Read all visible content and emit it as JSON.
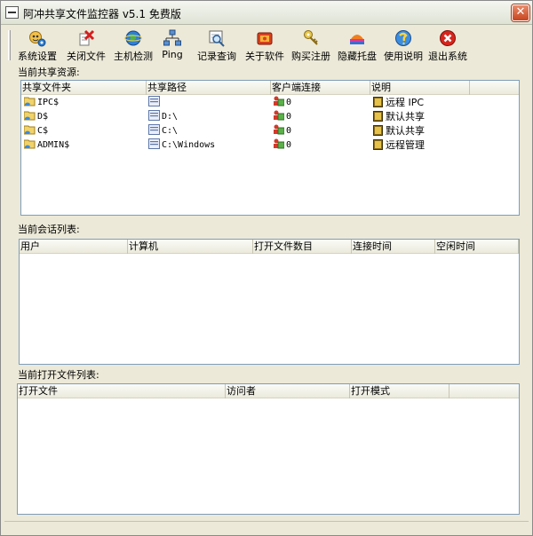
{
  "window": {
    "title": "阿冲共享文件监控器 v5.1 免费版",
    "close_glyph": "✕"
  },
  "toolbar": {
    "items": [
      {
        "id": "settings",
        "label": "系统设置",
        "icon": "gear-person-icon"
      },
      {
        "id": "close-file",
        "label": "关闭文件",
        "icon": "close-file-icon"
      },
      {
        "id": "host-check",
        "label": "主机检测",
        "icon": "globe-icon"
      },
      {
        "id": "ping",
        "label": "Ping",
        "icon": "network-icon"
      },
      {
        "id": "log",
        "label": "记录查询",
        "icon": "log-search-icon"
      },
      {
        "id": "about",
        "label": "关于软件",
        "icon": "about-icon"
      },
      {
        "id": "register",
        "label": "购买注册",
        "icon": "key-icon"
      },
      {
        "id": "tray",
        "label": "隐藏托盘",
        "icon": "tray-icon"
      },
      {
        "id": "help",
        "label": "使用说明",
        "icon": "help-icon"
      },
      {
        "id": "exit",
        "label": "退出系统",
        "icon": "exit-icon"
      }
    ]
  },
  "shares": {
    "label": "当前共享资源:",
    "columns": [
      "共享文件夹",
      "共享路径",
      "客户端连接",
      "说明"
    ],
    "rows": [
      {
        "name": "IPC$",
        "path": "",
        "clients": "0",
        "desc": "远程 IPC"
      },
      {
        "name": "D$",
        "path": "D:\\",
        "clients": "0",
        "desc": "默认共享"
      },
      {
        "name": "C$",
        "path": "C:\\",
        "clients": "0",
        "desc": "默认共享"
      },
      {
        "name": "ADMIN$",
        "path": "C:\\Windows",
        "clients": "0",
        "desc": "远程管理"
      }
    ]
  },
  "sessions": {
    "label": "当前会话列表:",
    "columns": [
      "用户",
      "计算机",
      "打开文件数目",
      "连接时间",
      "空闲时间"
    ]
  },
  "open_files": {
    "label": "当前打开文件列表:",
    "columns": [
      "打开文件",
      "访问者",
      "打开模式"
    ]
  }
}
